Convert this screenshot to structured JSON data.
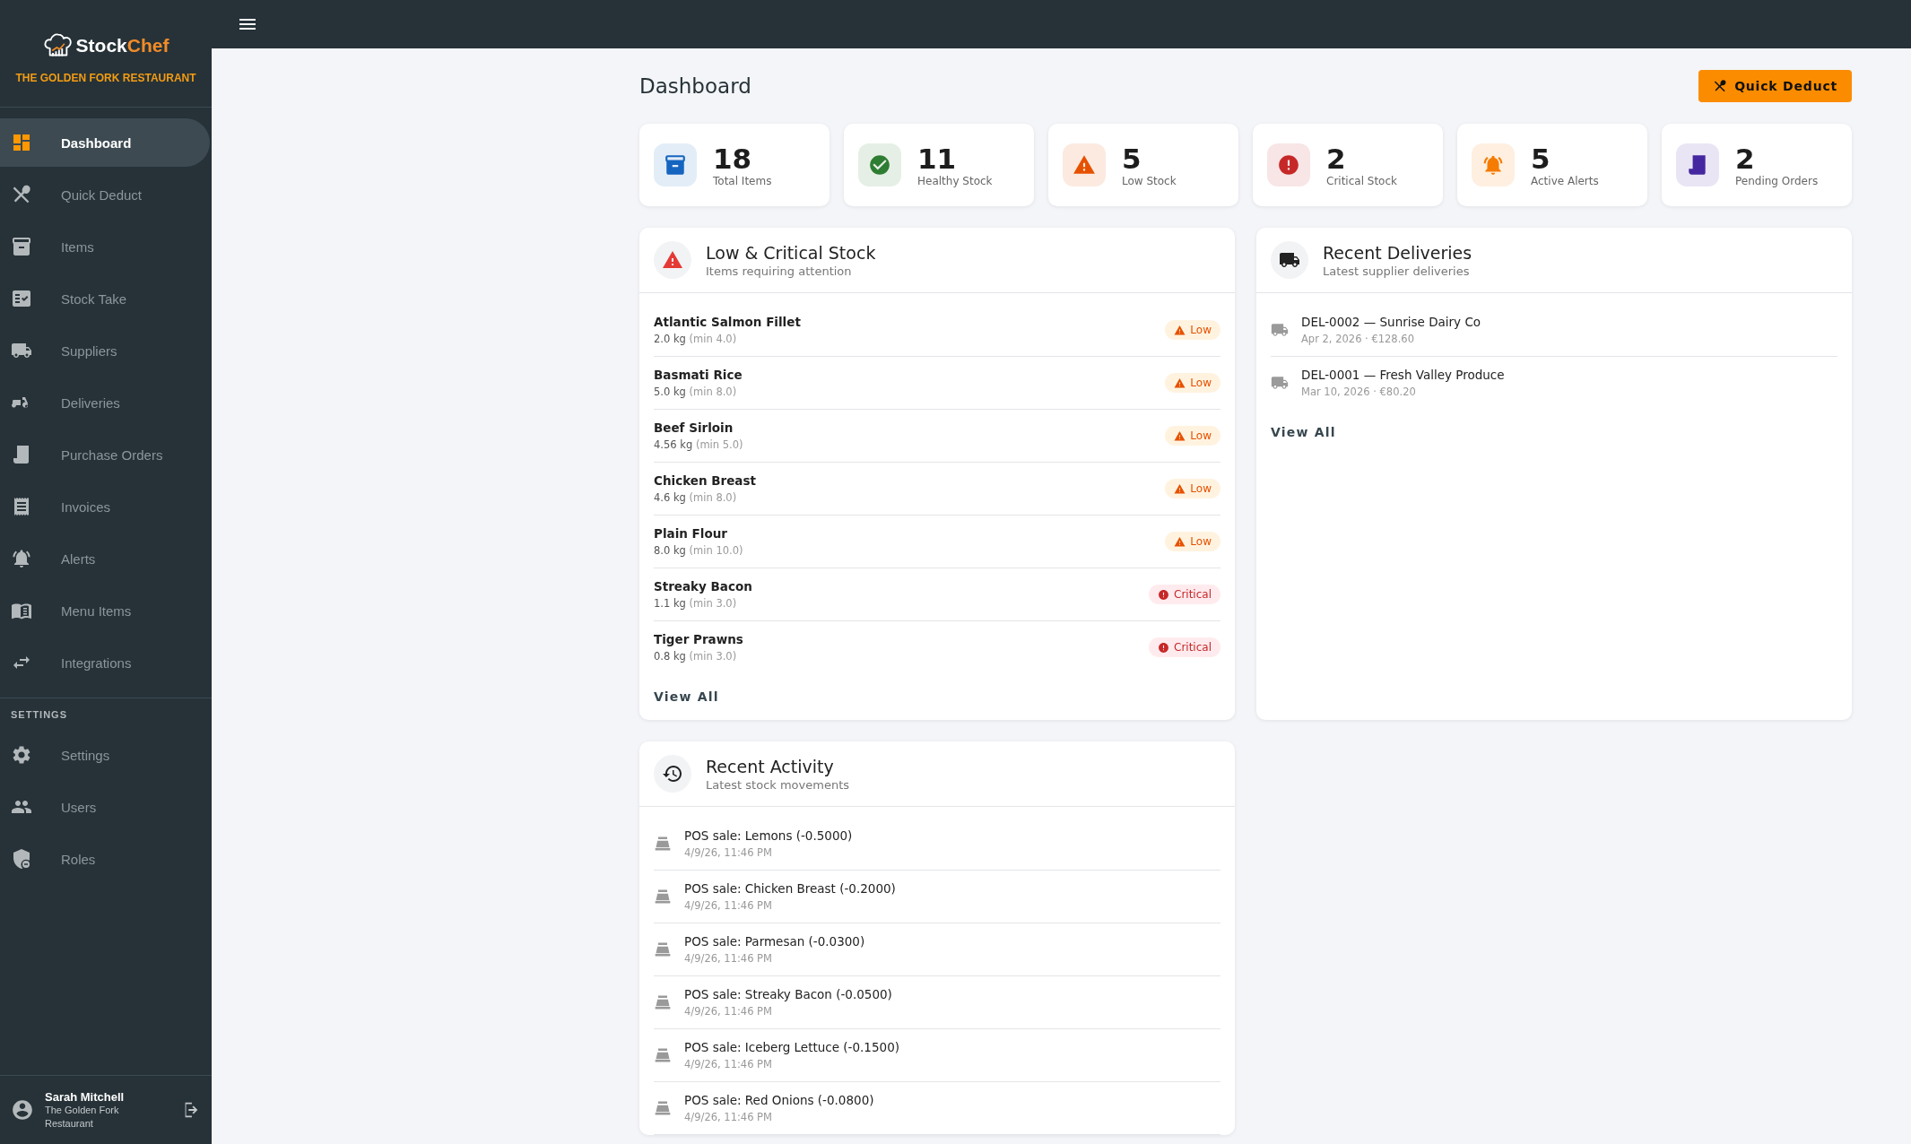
{
  "brand": {
    "name_start": "Stock",
    "name_end": "Chef",
    "restaurant": "THE GOLDEN FORK RESTAURANT"
  },
  "sidebar": {
    "items": [
      {
        "label": "Dashboard",
        "selected": true
      },
      {
        "label": "Quick Deduct",
        "selected": false
      },
      {
        "label": "Items",
        "selected": false
      },
      {
        "label": "Stock Take",
        "selected": false
      },
      {
        "label": "Suppliers",
        "selected": false
      },
      {
        "label": "Deliveries",
        "selected": false
      },
      {
        "label": "Purchase Orders",
        "selected": false
      },
      {
        "label": "Invoices",
        "selected": false
      },
      {
        "label": "Alerts",
        "selected": false
      },
      {
        "label": "Menu Items",
        "selected": false
      },
      {
        "label": "Integrations",
        "selected": false
      }
    ],
    "section_label": "SETTINGS",
    "settings_items": [
      {
        "label": "Settings",
        "selected": false
      },
      {
        "label": "Users",
        "selected": false
      },
      {
        "label": "Roles",
        "selected": false
      }
    ]
  },
  "user": {
    "name": "Sarah Mitchell",
    "restaurant": "The Golden Fork Restaurant"
  },
  "page": {
    "title": "Dashboard",
    "quick_deduct_button": "Quick Deduct"
  },
  "stats": [
    {
      "value": "18",
      "label": "Total Items",
      "color": "#1565c0"
    },
    {
      "value": "11",
      "label": "Healthy Stock",
      "color": "#2e7d32"
    },
    {
      "value": "5",
      "label": "Low Stock",
      "color": "#e65100"
    },
    {
      "value": "2",
      "label": "Critical Stock",
      "color": "#c62828"
    },
    {
      "value": "5",
      "label": "Active Alerts",
      "color": "#f57c00"
    },
    {
      "value": "2",
      "label": "Pending Orders",
      "color": "#4527a0"
    }
  ],
  "low_stock": {
    "title": "Low & Critical Stock",
    "subtitle": "Items requiring attention",
    "items": [
      {
        "name": "Atlantic Salmon Fillet",
        "quantity": "2.0 kg",
        "minimum": "(min 4.0)",
        "kind": "low",
        "badge": "Low"
      },
      {
        "name": "Basmati Rice",
        "quantity": "5.0 kg",
        "minimum": "(min 8.0)",
        "kind": "low",
        "badge": "Low"
      },
      {
        "name": "Beef Sirloin",
        "quantity": "4.56 kg",
        "minimum": "(min 5.0)",
        "kind": "low",
        "badge": "Low"
      },
      {
        "name": "Chicken Breast",
        "quantity": "4.6 kg",
        "minimum": "(min 8.0)",
        "kind": "low",
        "badge": "Low"
      },
      {
        "name": "Plain Flour",
        "quantity": "8.0 kg",
        "minimum": "(min 10.0)",
        "kind": "low",
        "badge": "Low"
      },
      {
        "name": "Streaky Bacon",
        "quantity": "1.1 kg",
        "minimum": "(min 3.0)",
        "kind": "critical",
        "badge": "Critical"
      },
      {
        "name": "Tiger Prawns",
        "quantity": "0.8 kg",
        "minimum": "(min 3.0)",
        "kind": "critical",
        "badge": "Critical"
      }
    ],
    "view_all": "View All"
  },
  "deliveries": {
    "title": "Recent Deliveries",
    "subtitle": "Latest supplier deliveries",
    "items": [
      {
        "title": "DEL-0002 — Sunrise Dairy Co",
        "meta": "Apr 2, 2026 · €128.60"
      },
      {
        "title": "DEL-0001 — Fresh Valley Produce",
        "meta": "Mar 10, 2026 · €80.20"
      }
    ],
    "view_all": "View All"
  },
  "activity": {
    "title": "Recent Activity",
    "subtitle": "Latest stock movements",
    "items": [
      {
        "text": "POS sale: Lemons (-0.5000)",
        "time": "4/9/26, 11:46 PM"
      },
      {
        "text": "POS sale: Chicken Breast (-0.2000)",
        "time": "4/9/26, 11:46 PM"
      },
      {
        "text": "POS sale: Parmesan (-0.0300)",
        "time": "4/9/26, 11:46 PM"
      },
      {
        "text": "POS sale: Streaky Bacon (-0.0500)",
        "time": "4/9/26, 11:46 PM"
      },
      {
        "text": "POS sale: Iceberg Lettuce (-0.1500)",
        "time": "4/9/26, 11:46 PM"
      },
      {
        "text": "POS sale: Red Onions (-0.0800)",
        "time": "4/9/26, 11:46 PM"
      }
    ]
  }
}
